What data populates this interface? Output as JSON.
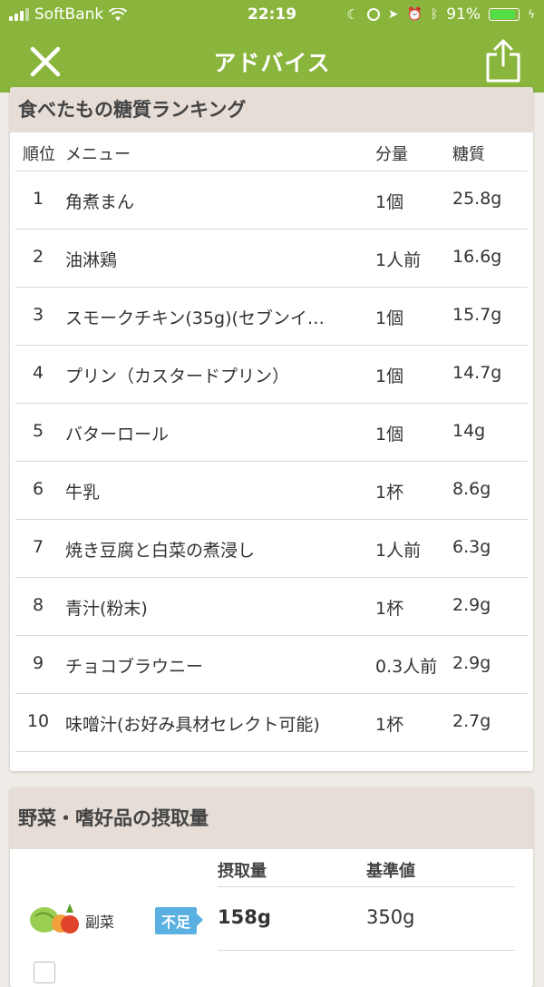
{
  "status_bar": {
    "carrier": "SoftBank",
    "time": "22:19",
    "battery": "91%"
  },
  "nav": {
    "title": "アドバイス"
  },
  "ranking": {
    "section_title": "食べたもの糖質ランキング",
    "headers": {
      "rank": "順位",
      "menu": "メニュー",
      "amount": "分量",
      "carb": "糖質"
    },
    "rows": [
      {
        "rank": "1",
        "menu": "角煮まん",
        "amount": "1個",
        "carb": "25.8g"
      },
      {
        "rank": "2",
        "menu": "油淋鶏",
        "amount": "1人前",
        "carb": "16.6g"
      },
      {
        "rank": "3",
        "menu": "スモークチキン(35g)(セブンイ…",
        "amount": "1個",
        "carb": "15.7g"
      },
      {
        "rank": "4",
        "menu": "プリン（カスタードプリン）",
        "amount": "1個",
        "carb": "14.7g"
      },
      {
        "rank": "5",
        "menu": "バターロール",
        "amount": "1個",
        "carb": "14g"
      },
      {
        "rank": "6",
        "menu": "牛乳",
        "amount": "1杯",
        "carb": "8.6g"
      },
      {
        "rank": "7",
        "menu": "焼き豆腐と白菜の煮浸し",
        "amount": "1人前",
        "carb": "6.3g"
      },
      {
        "rank": "8",
        "menu": "青汁(粉末)",
        "amount": "1杯",
        "carb": "2.9g"
      },
      {
        "rank": "9",
        "menu": "チョコブラウニー",
        "amount": "0.3人前",
        "carb": "2.9g"
      },
      {
        "rank": "10",
        "menu": "味噌汁(お好み具材セレクト可能)",
        "amount": "1杯",
        "carb": "2.7g"
      }
    ]
  },
  "intake": {
    "section_title": "野菜・嗜好品の摂取量",
    "headers": {
      "intake": "摂取量",
      "standard": "基準値"
    },
    "rows": [
      {
        "name": "副菜",
        "status": "不足",
        "intake": "158g",
        "standard": "350g"
      }
    ]
  },
  "colors": {
    "accent": "#8ab53c",
    "badge": "#5ab0e0",
    "section_bg": "#e5ddd6"
  }
}
